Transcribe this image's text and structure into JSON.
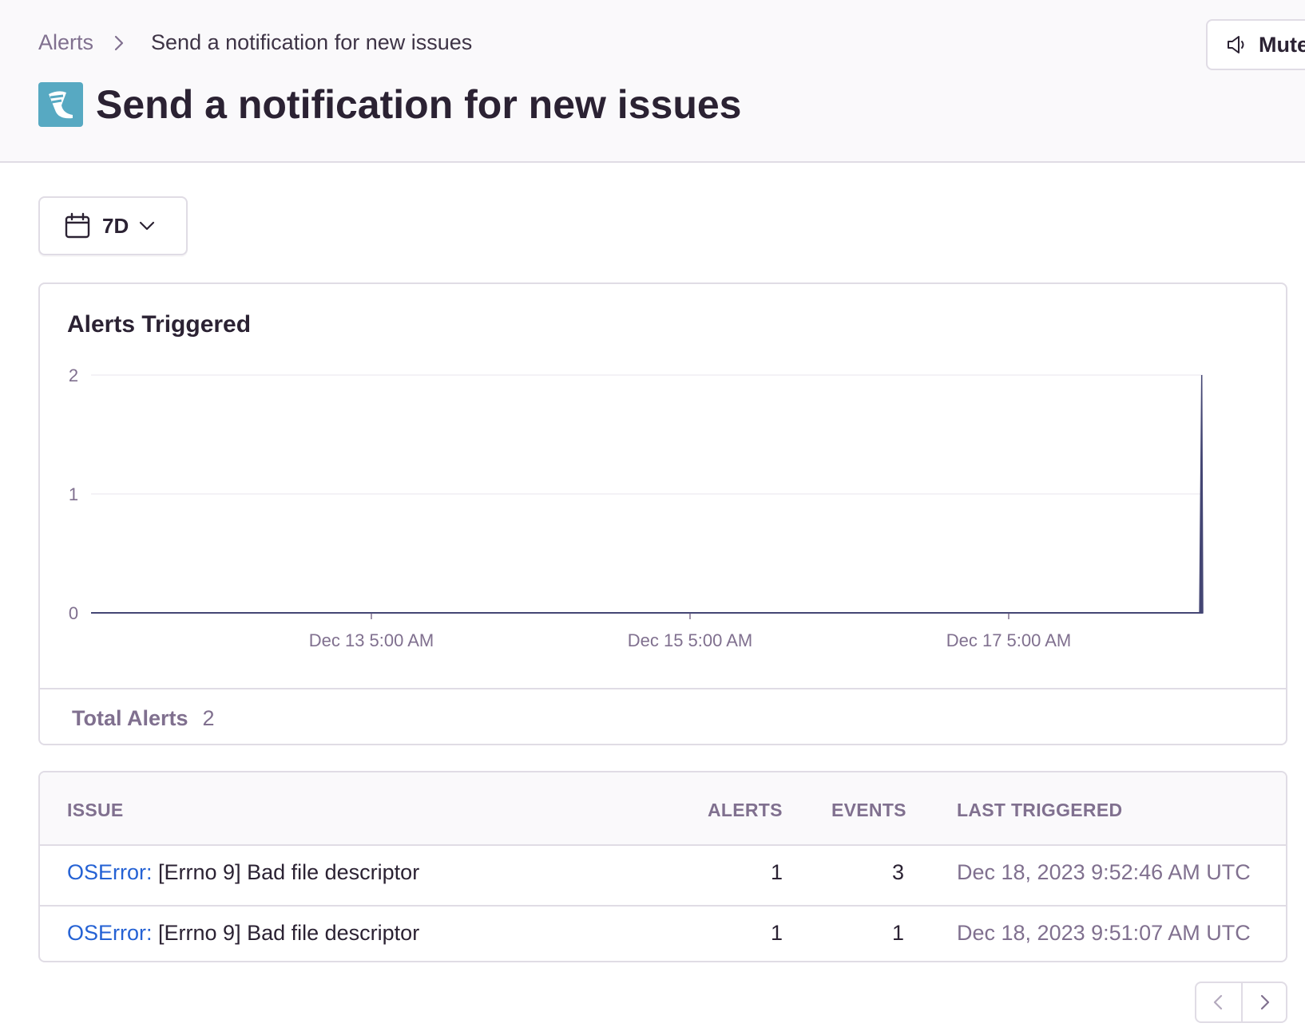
{
  "breadcrumb": {
    "parent": "Alerts",
    "current": "Send a notification for new issues"
  },
  "header": {
    "title": "Send a notification for new issues",
    "project_icon": "python-platform-icon",
    "mute_label": "Mute"
  },
  "filters": {
    "time_range": "7D"
  },
  "chart": {
    "title": "Alerts Triggered",
    "total_label": "Total Alerts",
    "total_value": "2"
  },
  "chart_data": {
    "type": "area",
    "title": "Alerts Triggered",
    "xlabel": "",
    "ylabel": "",
    "y_ticks": [
      "0",
      "1",
      "2"
    ],
    "x_ticks": [
      "Dec 13 5:00 AM",
      "Dec 15 5:00 AM",
      "Dec 17 5:00 AM"
    ],
    "ylim": [
      0,
      2
    ],
    "grid": true,
    "series": [
      {
        "values": [
          {
            "x": "Dec 11 2023",
            "y": 0
          },
          {
            "x": "Dec 18 2023 09:30",
            "y": 0
          },
          {
            "x": "Dec 18 2023 09:50",
            "y": 2
          },
          {
            "x": "Dec 18 2023 10:00",
            "y": 0
          }
        ]
      }
    ],
    "color": "#444674"
  },
  "table": {
    "headers": {
      "issue": "ISSUE",
      "alerts": "ALERTS",
      "events": "EVENTS",
      "last_triggered": "LAST TRIGGERED"
    },
    "rows": [
      {
        "type": "OSError:",
        "message": "[Errno 9] Bad file descriptor",
        "alerts": "1",
        "events": "3",
        "last_triggered": "Dec 18, 2023 9:52:46 AM UTC"
      },
      {
        "type": "OSError:",
        "message": "[Errno 9] Bad file descriptor",
        "alerts": "1",
        "events": "1",
        "last_triggered": "Dec 18, 2023 9:51:07 AM UTC"
      }
    ]
  },
  "colors": {
    "link": "#2562d4",
    "muted_text": "#80708f",
    "border": "#e0dce5",
    "chart_series": "#444674"
  }
}
